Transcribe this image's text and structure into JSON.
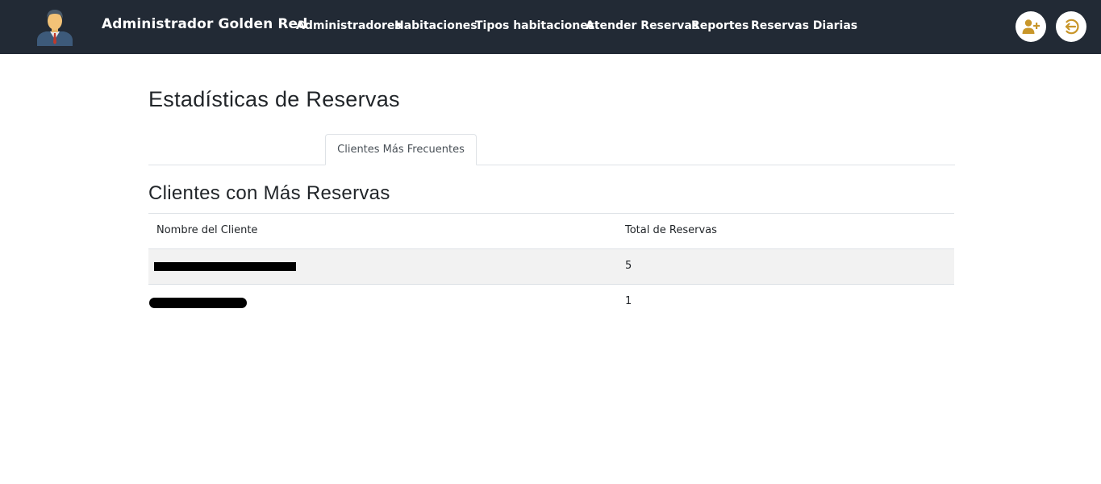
{
  "header": {
    "brand": "Administrador Golden Red",
    "nav": [
      {
        "label": "Administradores"
      },
      {
        "label": "Habitaciones"
      },
      {
        "label": "Tipos habitaciones"
      },
      {
        "label": "Atender Reservas"
      },
      {
        "label": "Reportes"
      },
      {
        "label": "Reservas Diarias"
      }
    ],
    "accent_color": "#c8962a",
    "actions": [
      {
        "icon": "add-user-icon"
      },
      {
        "icon": "logout-icon"
      }
    ]
  },
  "main": {
    "title": "Estadísticas de Reservas",
    "tabs": [
      {
        "label": "Clientes Más Frecuentes",
        "active": true
      }
    ],
    "section_title": "Clientes con Más Reservas",
    "table": {
      "columns": [
        "Nombre del Cliente",
        "Total de Reservas"
      ],
      "rows": [
        {
          "name": "",
          "total": "5"
        },
        {
          "name": "",
          "total": "1"
        }
      ]
    }
  }
}
